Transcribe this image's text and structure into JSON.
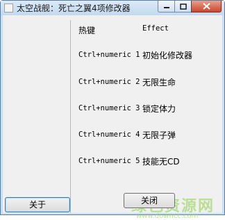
{
  "window": {
    "title": "太空战舰：死亡之翼4项修改器"
  },
  "table": {
    "header_hotkey": "热键",
    "header_effect": "Effect",
    "rows": [
      {
        "key": "Ctrl+numeric 1",
        "effect": "初始化修改器"
      },
      {
        "key": "Ctrl+numeric 2",
        "effect": "无限生命"
      },
      {
        "key": "Ctrl+numeric 3",
        "effect": "锁定体力"
      },
      {
        "key": "Ctrl+numeric 4",
        "effect": "无限子弹"
      },
      {
        "key": "Ctrl+numeric 5",
        "effect": "技能无CD"
      }
    ]
  },
  "buttons": {
    "about": "关于",
    "close": "关闭"
  },
  "watermark": {
    "text": "绿色资源网",
    "url": "www.downcc.com"
  },
  "colors": {
    "titlebar": "#c7dff3",
    "close_button": "#c9452b",
    "watermark": "#8fd14a"
  }
}
